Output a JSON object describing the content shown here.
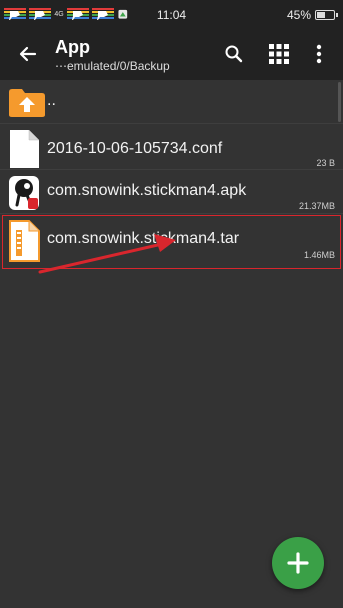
{
  "status_bar": {
    "network_label": "4G",
    "time": "11:04",
    "battery_text": "45%",
    "battery_level": 0.45
  },
  "app_bar": {
    "title": "App",
    "path": "⋯emulated/0/Backup",
    "back_icon": "arrow-left-icon",
    "search_icon": "search-icon",
    "grid_icon": "grid-view-icon",
    "overflow_icon": "more-vert-icon"
  },
  "file_list": {
    "parent_label": "..",
    "items": [
      {
        "name": "2016-10-06-105734.conf",
        "size": "23 B",
        "icon": "document-icon"
      },
      {
        "name": "com.snowink.stickman4.apk",
        "size": "21.37MB",
        "icon": "app-icon"
      },
      {
        "name": "com.snowink.stickman4.tar",
        "size": "1.46MB",
        "icon": "archive-file-icon"
      }
    ]
  },
  "fab": {
    "icon": "add-icon"
  },
  "colors": {
    "background": "#333333",
    "appbar": "#222222",
    "accent_orange": "#f59a2d",
    "fab_green": "#3aa047",
    "annotation_red": "#d9262d"
  }
}
